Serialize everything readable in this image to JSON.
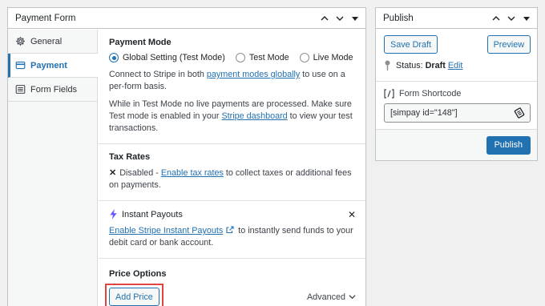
{
  "form_panel": {
    "title": "Payment Form",
    "tabs": [
      {
        "label": "General",
        "icon": "gear-icon"
      },
      {
        "label": "Payment",
        "icon": "card-icon",
        "active": true
      },
      {
        "label": "Form Fields",
        "icon": "list-icon"
      }
    ],
    "payment_mode": {
      "title": "Payment Mode",
      "options": [
        {
          "label": "Global Setting (Test Mode)",
          "checked": true
        },
        {
          "label": "Test Mode",
          "checked": false
        },
        {
          "label": "Live Mode",
          "checked": false
        }
      ],
      "para1_before": "Connect to Stripe in both ",
      "para1_link": "payment modes globally",
      "para1_after": " to use on a per-form basis.",
      "para2_before": "While in Test Mode no live payments are processed. Make sure Test mode is enabled in your ",
      "para2_link": "Stripe dashboard",
      "para2_after": " to view your test transactions."
    },
    "tax_rates": {
      "title": "Tax Rates",
      "status_mark": "✕",
      "before": "Disabled - ",
      "link": "Enable tax rates",
      "after": " to collect taxes or additional fees on payments."
    },
    "instant_payouts": {
      "title": "Instant Payouts",
      "dismiss": "✕",
      "link": "Enable Stripe Instant Payouts",
      "after": " to instantly send funds to your debit card or bank account."
    },
    "price_options": {
      "title": "Price Options",
      "add_price_label": "Add Price",
      "advanced_label": "Advanced"
    }
  },
  "publish_panel": {
    "title": "Publish",
    "save_draft_label": "Save Draft",
    "preview_label": "Preview",
    "status_label": "Status:",
    "status_value": "Draft",
    "status_edit": "Edit",
    "shortcode_label": "Form Shortcode",
    "shortcode_value": "[simpay id=\"148\"]",
    "publish_label": "Publish"
  },
  "colors": {
    "accent": "#2271b1",
    "highlight": "#e0443e",
    "bolt": "#635bff"
  }
}
